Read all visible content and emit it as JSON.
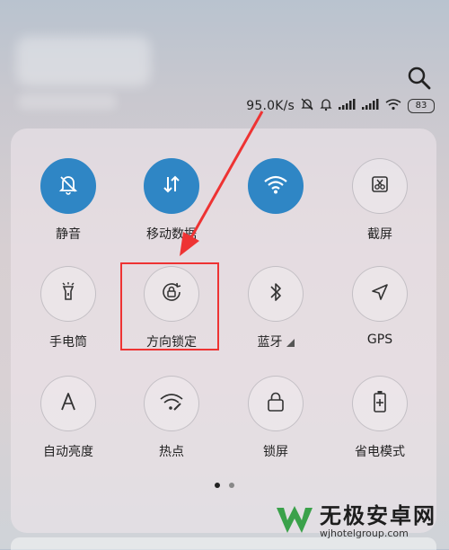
{
  "status": {
    "speed": "95.0K/s",
    "battery": "83"
  },
  "tiles": [
    {
      "label": "静音",
      "icon": "mute-bell-icon",
      "active": true
    },
    {
      "label": "移动数据",
      "icon": "mobile-data-icon",
      "active": true
    },
    {
      "label": "",
      "icon": "wifi-icon",
      "active": true
    },
    {
      "label": "截屏",
      "icon": "screenshot-icon",
      "active": false
    },
    {
      "label": "手电筒",
      "icon": "flashlight-icon",
      "active": false
    },
    {
      "label": "方向锁定",
      "icon": "rotation-lock-icon",
      "active": false
    },
    {
      "label": "蓝牙",
      "icon": "bluetooth-icon",
      "active": false
    },
    {
      "label": "GPS",
      "icon": "gps-icon",
      "active": false
    },
    {
      "label": "自动亮度",
      "icon": "auto-brightness-icon",
      "active": false
    },
    {
      "label": "热点",
      "icon": "hotspot-icon",
      "active": false
    },
    {
      "label": "锁屏",
      "icon": "lock-icon",
      "active": false
    },
    {
      "label": "省电模式",
      "icon": "battery-saver-icon",
      "active": false
    }
  ],
  "pager": {
    "pages": 2,
    "current": 1
  },
  "watermark": {
    "title": "无极安卓网",
    "url": "wjhotelgroup.com"
  },
  "colors": {
    "accent": "#2f86c5",
    "annotation": "#e33333"
  }
}
